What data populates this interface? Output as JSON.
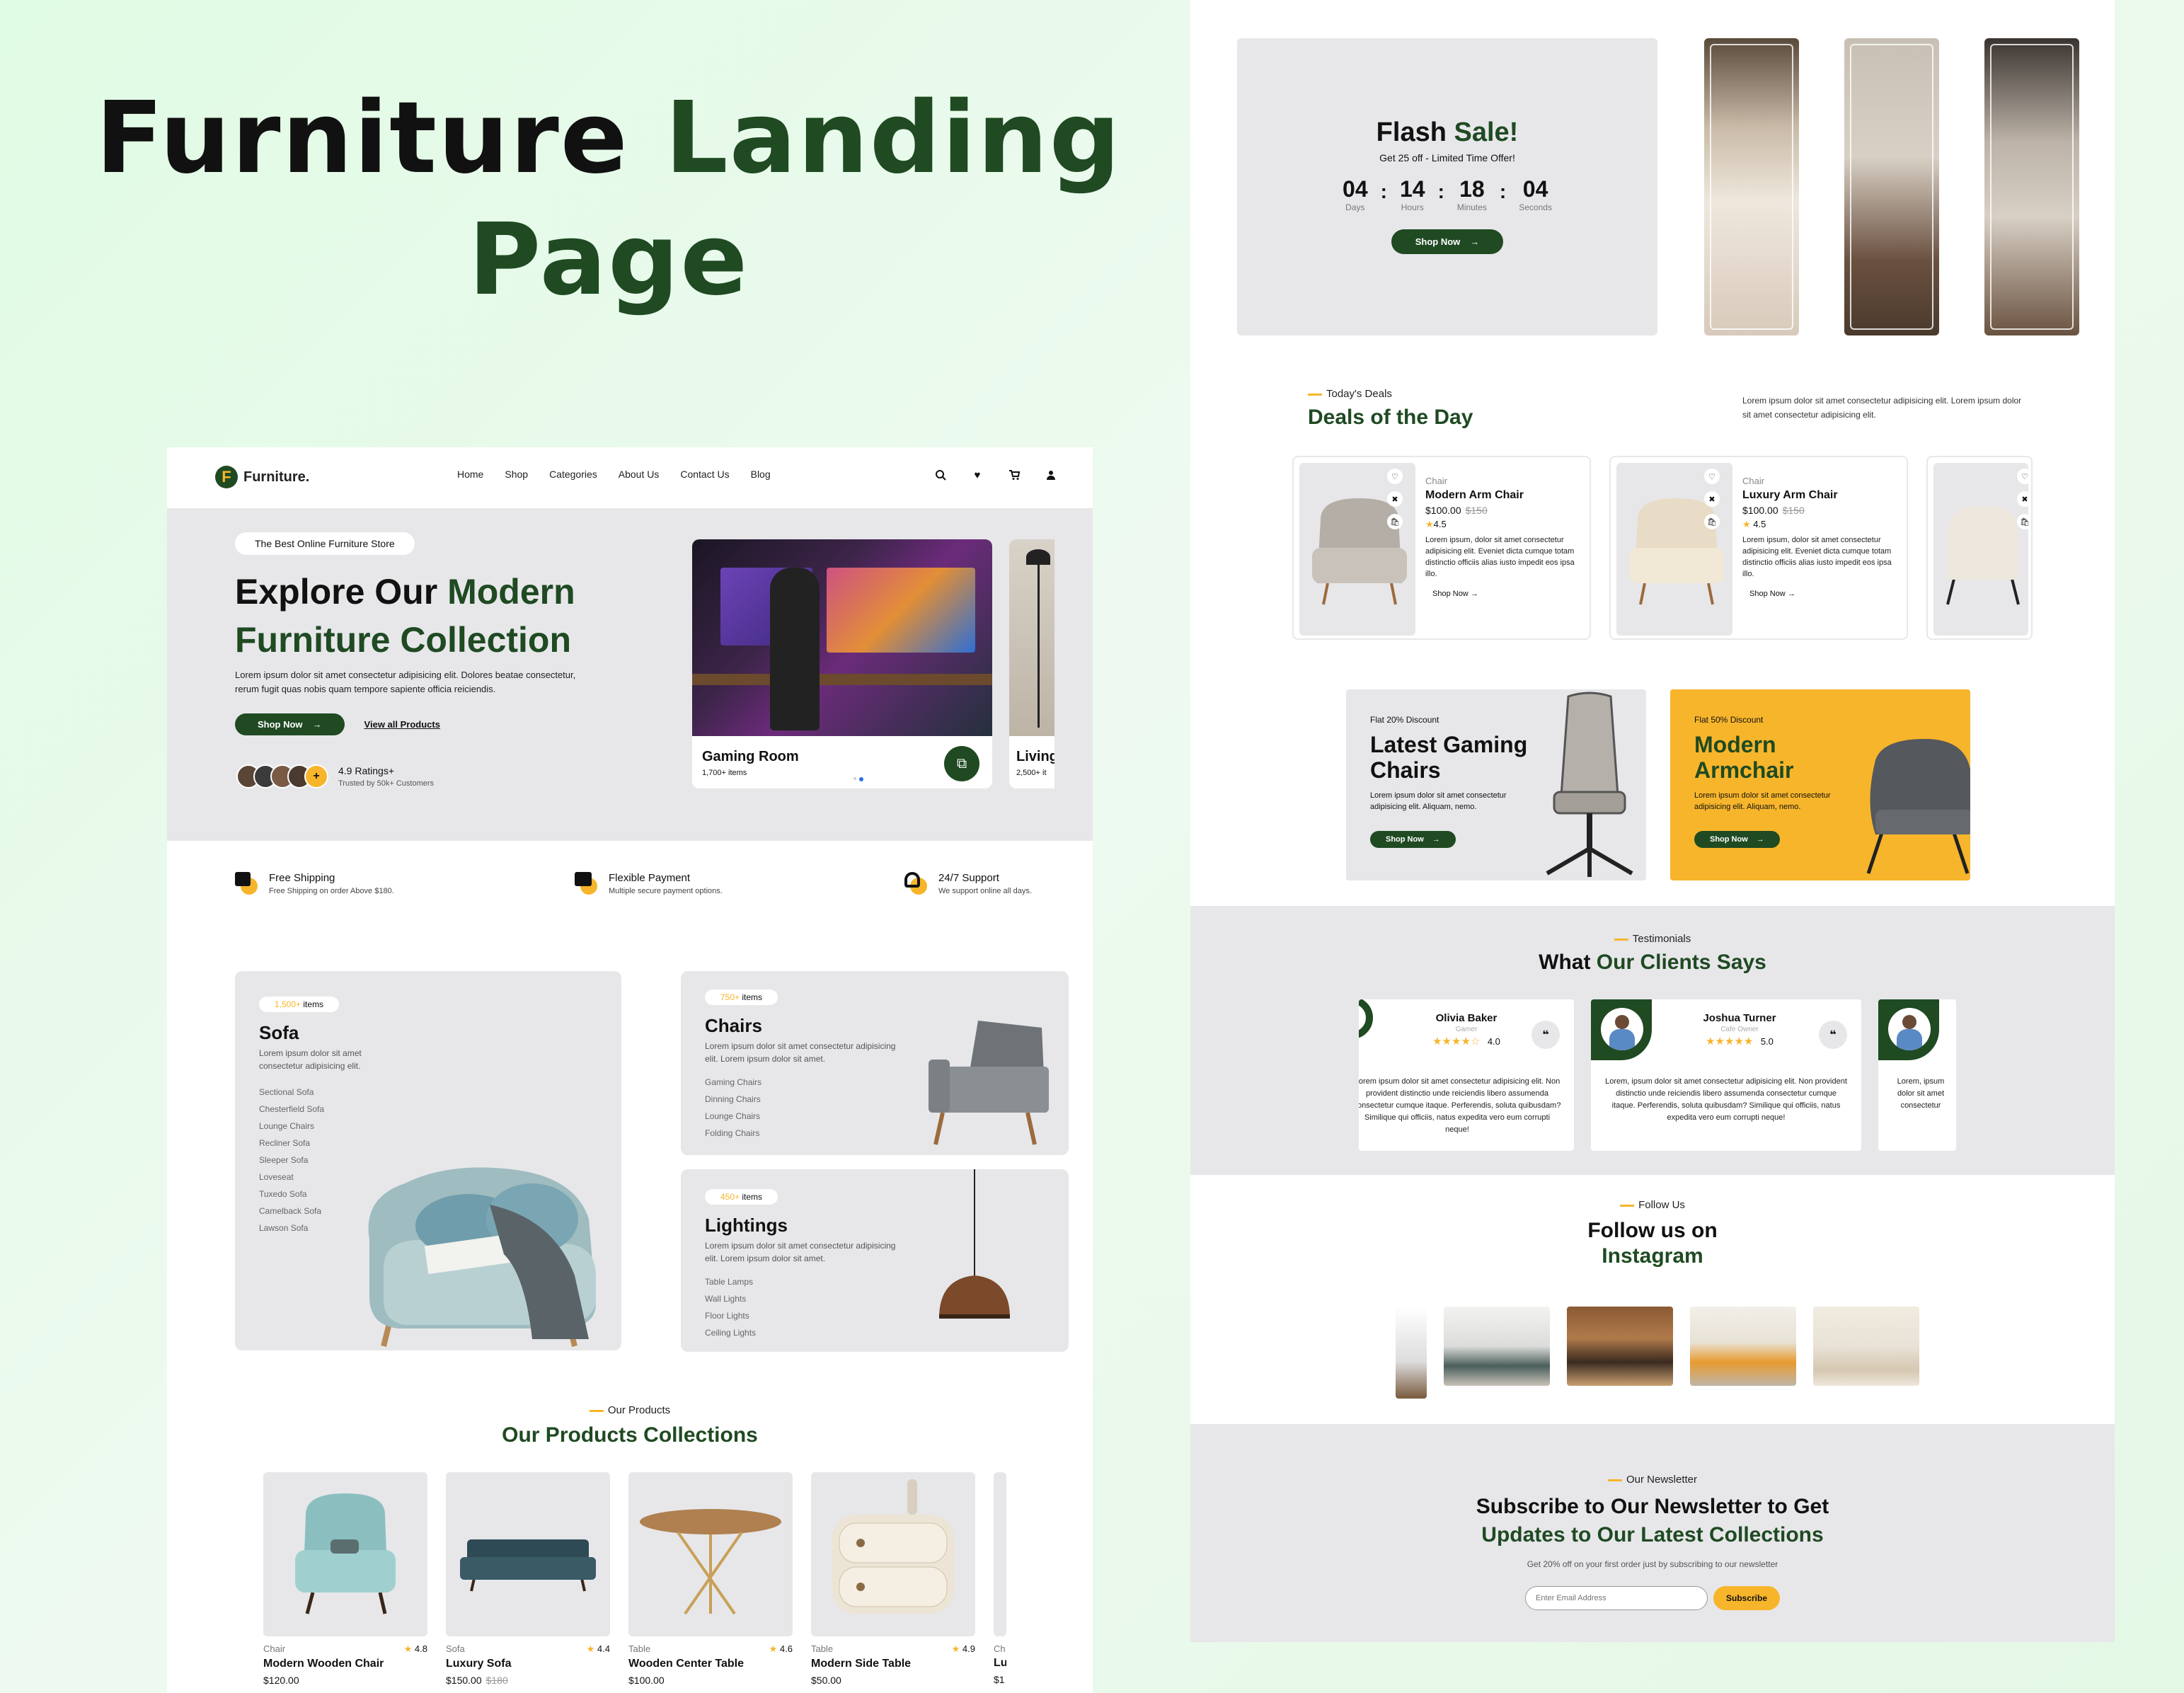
{
  "headline": {
    "part1": "Furniture",
    "part2": "Landing",
    "part3": "Page"
  },
  "colors": {
    "primary": "#1f4a22",
    "accent": "#f7b52b",
    "panel": "#e7e7ea"
  },
  "left_page": {
    "brand": {
      "initial": "F",
      "name": "Furniture."
    },
    "nav": [
      "Home",
      "Shop",
      "Categories",
      "About Us",
      "Contact Us",
      "Blog"
    ],
    "nav_icons": [
      "search-icon",
      "heart-icon",
      "cart-icon",
      "user-icon"
    ],
    "hero": {
      "badge": "The Best Online Furniture Store",
      "title_a": "Explore Our ",
      "title_b": "Modern",
      "title_c": "Furniture Collection",
      "desc": "Lorem ipsum dolor sit amet consectetur adipisicing elit. Dolores beatae consectetur, rerum fugit quas nobis quam tempore sapiente officia reiciendis.",
      "shop_btn": "Shop Now",
      "view_all": "View all Products",
      "rating": "4.9 Ratings+",
      "trusted": "Trusted by 50k+ Customers",
      "rooms": [
        {
          "name": "Gaming Room",
          "count": "1,700+ items"
        },
        {
          "name": "Living",
          "count": "2,500+ it"
        }
      ]
    },
    "features": [
      {
        "title": "Free Shipping",
        "sub": "Free Shipping on order Above $180."
      },
      {
        "title": "Flexible Payment",
        "sub": "Multiple secure payment options."
      },
      {
        "title": "24/7 Support",
        "sub": "We support online all days."
      }
    ],
    "categories": [
      {
        "count": "1,500+",
        "unit": "items",
        "title": "Sofa",
        "desc": "Lorem ipsum dolor sit amet consectetur adipisicing elit.",
        "items": [
          "Sectional Sofa",
          "Chesterfield Sofa",
          "Lounge Chairs",
          "Recliner Sofa",
          "Sleeper Sofa",
          "Loveseat",
          "Tuxedo Sofa",
          "Camelback Sofa",
          "Lawson Sofa"
        ]
      },
      {
        "count": "750+",
        "unit": "items",
        "title": "Chairs",
        "desc": "Lorem ipsum dolor sit amet consectetur adipisicing elit. Lorem ipsum dolor sit amet.",
        "items": [
          "Gaming Chairs",
          "Dinning Chairs",
          "Lounge Chairs",
          "Folding Chairs"
        ]
      },
      {
        "count": "450+",
        "unit": "items",
        "title": "Lightings",
        "desc": "Lorem ipsum dolor sit amet consectetur adipisicing elit. Lorem ipsum dolor sit amet.",
        "items": [
          "Table Lamps",
          "Wall Lights",
          "Floor Lights",
          "Ceiling Lights"
        ]
      }
    ],
    "products_section": {
      "kicker": "Our Products",
      "title": "Our Products Collections"
    },
    "products": [
      {
        "cat": "Chair",
        "rating": "4.8",
        "name": "Modern Wooden Chair",
        "price": "$120.00",
        "old": ""
      },
      {
        "cat": "Sofa",
        "rating": "4.4",
        "name": "Luxury Sofa",
        "price": "$150.00",
        "old": "$180"
      },
      {
        "cat": "Table",
        "rating": "4.6",
        "name": "Wooden Center Table",
        "price": "$100.00",
        "old": ""
      },
      {
        "cat": "Table",
        "rating": "4.9",
        "name": "Modern Side Table",
        "price": "$50.00",
        "old": ""
      },
      {
        "cat": "Ch",
        "rating": "",
        "name": "Lu",
        "price": "$1",
        "old": ""
      }
    ]
  },
  "right_page": {
    "flash": {
      "title_a": "Flash ",
      "title_b": "Sale!",
      "sub": "Get 25 off - Limited Time Offer!",
      "countdown": [
        {
          "num": "04",
          "label": "Days"
        },
        {
          "num": "14",
          "label": "Hours"
        },
        {
          "num": "18",
          "label": "Minutes"
        },
        {
          "num": "04",
          "label": "Seconds"
        }
      ],
      "btn": "Shop Now"
    },
    "deals_section": {
      "kicker": "Today's Deals",
      "title": "Deals of the Day",
      "desc": "Lorem ipsum dolor sit amet consectetur adipisicing elit. Lorem ipsum dolor sit amet consectetur adipisicing elit."
    },
    "deals": [
      {
        "cat": "Chair",
        "name": "Modern Arm Chair",
        "price": "$100.00",
        "old": "$150",
        "rating": "4.5",
        "desc": "Lorem ipsum, dolor sit amet consectetur adipisicing elit. Eveniet dicta cumque totam distinctio officiis alias iusto impedit eos ipsa illo.",
        "btn": "Shop Now"
      },
      {
        "cat": "Chair",
        "name": "Luxury Arm Chair",
        "price": "$100.00",
        "old": "$150",
        "rating": "4.5",
        "desc": "Lorem ipsum, dolor sit amet consectetur adipisicing elit. Eveniet dicta cumque totam distinctio officiis alias iusto impedit eos ipsa illo.",
        "btn": "Shop Now"
      }
    ],
    "promos": [
      {
        "kicker": "Flat 20% Discount",
        "title_a": "Latest Gaming",
        "title_b": "Chairs",
        "desc": "Lorem ipsum dolor sit amet consectetur adipisicing elit. Aliquam, nemo.",
        "btn": "Shop Now"
      },
      {
        "kicker": "Flat 50% Discount",
        "title_a": "Modern",
        "title_b": "Armchair",
        "desc": "Lorem ipsum dolor sit amet consectetur adipisicing elit. Aliquam, nemo.",
        "btn": "Shop Now"
      }
    ],
    "testimonials_section": {
      "kicker": "Testimonials",
      "title_a": "What ",
      "title_b": "Our Clients Says"
    },
    "testimonials": [
      {
        "name": "Olivia Baker",
        "role": "Gamer",
        "stars": "★★★★☆",
        "rating": "4.0",
        "text": "Lorem ipsum dolor sit amet consectetur adipisicing elit. Non provident distinctio unde reiciendis libero assumenda consectetur cumque itaque. Perferendis, soluta quibusdam? Similique qui officiis, natus expedita vero eum corrupti neque!"
      },
      {
        "name": "Joshua Turner",
        "role": "Cafe Owner",
        "stars": "★★★★★",
        "rating": "5.0",
        "text": "Lorem, ipsum dolor sit amet consectetur adipisicing elit. Non provident distinctio unde reiciendis libero assumenda consectetur cumque itaque. Perferendis, soluta quibusdam? Similique qui officiis, natus expedita vero eum corrupti neque!"
      },
      {
        "name": "",
        "role": "",
        "stars": "",
        "rating": "",
        "text": "Lorem, ipsum dolor sit amet consectetur adipisicing elit. Non provident distinctio unde officiis,"
      }
    ],
    "instagram": {
      "kicker": "Follow Us",
      "title_a": "Follow us on",
      "title_b": "Instagram"
    },
    "newsletter": {
      "kicker": "Our Newsletter",
      "title_a": "Subscribe to Our Newsletter to Get",
      "title_b": "Updates to Our Latest Collections",
      "desc": "Get 20% off on your first order just by subscribing to our newsletter",
      "placeholder": "Enter Email Address",
      "btn": "Subscribe"
    }
  }
}
